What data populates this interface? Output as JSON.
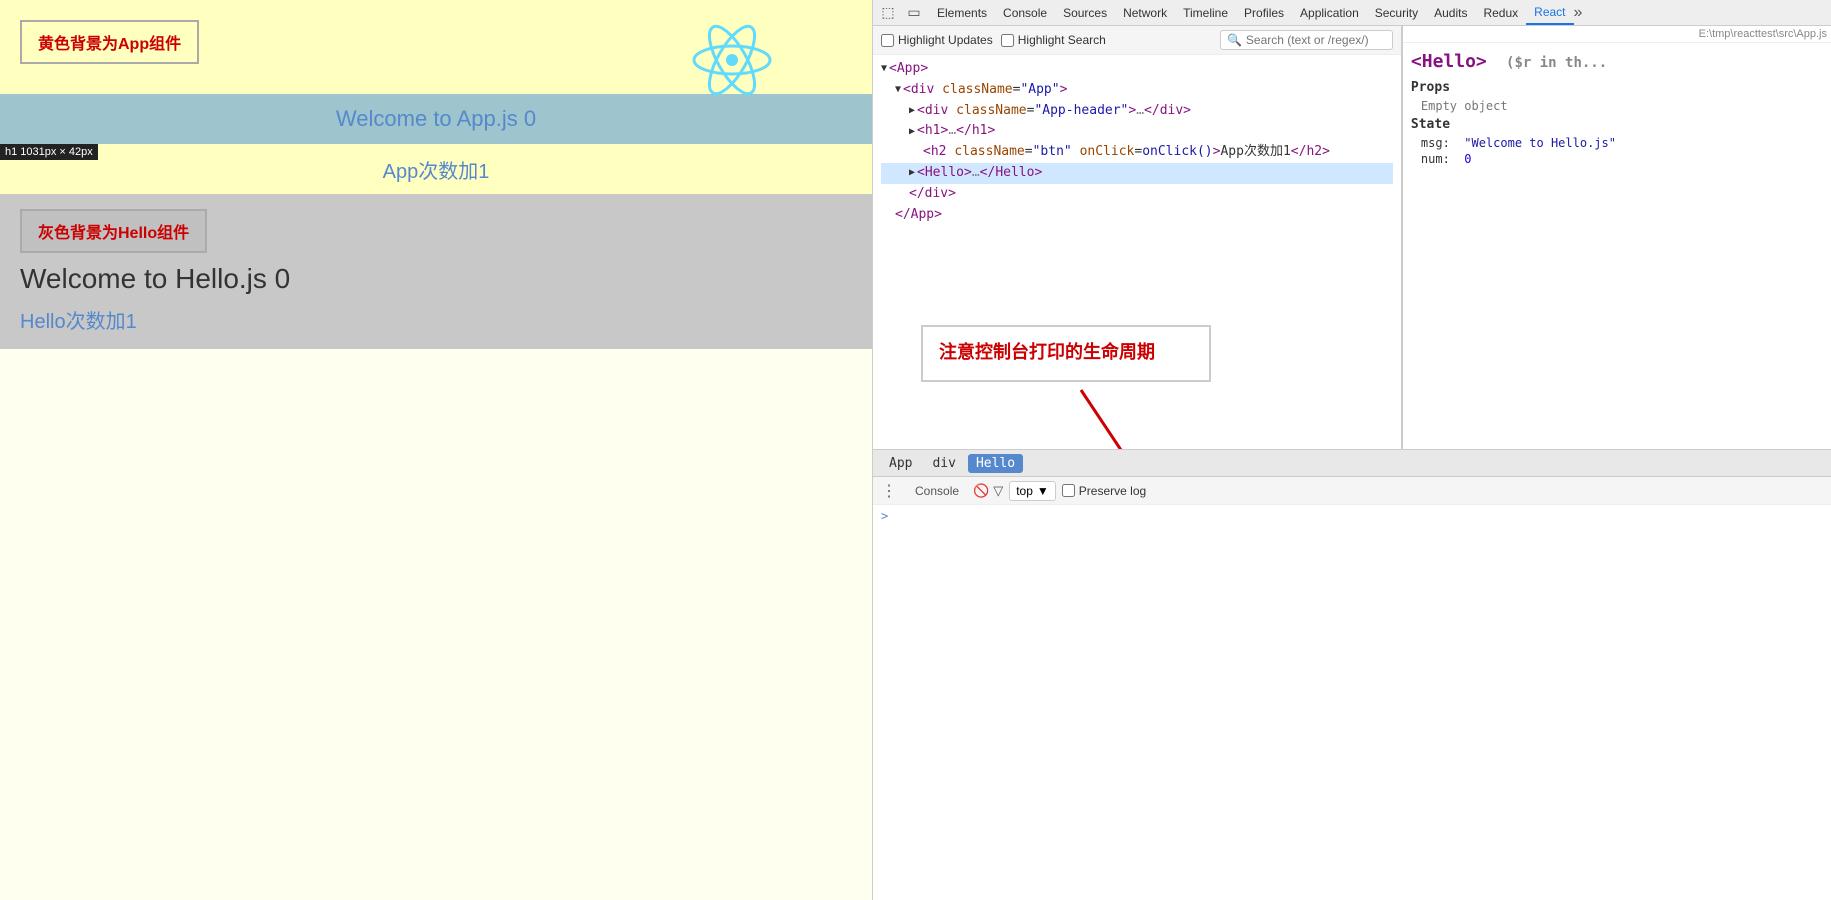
{
  "preview": {
    "app_label": "黄色背景为App组件",
    "welcome_app": "Welcome to App.js 0",
    "app_btn": "App次数加1",
    "size_badge": "h1 1031px × 42px",
    "hello_label": "灰色背景为Hello组件",
    "welcome_hello": "Welcome to Hello.js 0",
    "hello_btn": "Hello次数加1"
  },
  "devtools": {
    "tabs": [
      {
        "label": "Elements",
        "active": false
      },
      {
        "label": "Console",
        "active": false
      },
      {
        "label": "Sources",
        "active": false
      },
      {
        "label": "Network",
        "active": false
      },
      {
        "label": "Timeline",
        "active": false
      },
      {
        "label": "Profiles",
        "active": false
      },
      {
        "label": "Application",
        "active": false
      },
      {
        "label": "Security",
        "active": false
      },
      {
        "label": "Audits",
        "active": false
      },
      {
        "label": "Redux",
        "active": false
      },
      {
        "label": "React",
        "active": true
      }
    ],
    "highlight_updates": "Highlight Updates",
    "highlight_search": "Highlight Search",
    "search_placeholder": "Search (text or /regex/)",
    "dom": {
      "lines": [
        {
          "indent": 0,
          "content": "<App>",
          "type": "open",
          "expanded": true
        },
        {
          "indent": 1,
          "content": "<div className=\"App\">",
          "type": "open",
          "expanded": true
        },
        {
          "indent": 2,
          "content": "<div className=\"App-header\">…</div>",
          "type": "leaf"
        },
        {
          "indent": 2,
          "content": "<h1>…</h1>",
          "type": "leaf"
        },
        {
          "indent": 2,
          "content": "<h2 className=\"btn\" onClick=onClick()>App次数加1</h2>",
          "type": "leaf",
          "selected": false
        },
        {
          "indent": 2,
          "content": "<Hello>…</Hello>",
          "type": "leaf",
          "selected": true
        },
        {
          "indent": 1,
          "content": "</div>",
          "type": "close"
        },
        {
          "indent": 0,
          "content": "</App>",
          "type": "close"
        }
      ]
    },
    "react_panel": {
      "component": "<Hello>",
      "props_title": "Props",
      "props_empty": "Empty object",
      "state_title": "State",
      "state_msg_key": "msg:",
      "state_msg_val": "\"Welcome to Hello.js\"",
      "state_num_key": "num:",
      "state_num_val": "0"
    },
    "breadcrumbs": [
      {
        "label": "App",
        "active": false
      },
      {
        "label": "div",
        "active": false
      },
      {
        "label": "Hello",
        "active": true
      }
    ],
    "console": {
      "kebab": "⋮",
      "tab_label": "Console",
      "filter_icons": [
        "🚫",
        "▽"
      ],
      "top_label": "top",
      "preserve_log": "Preserve log",
      "prompt": ">"
    },
    "annotation": "注意控制台打印的生命周期",
    "file_path": "E:\\tmp\\reacttest\\src\\App.js"
  }
}
